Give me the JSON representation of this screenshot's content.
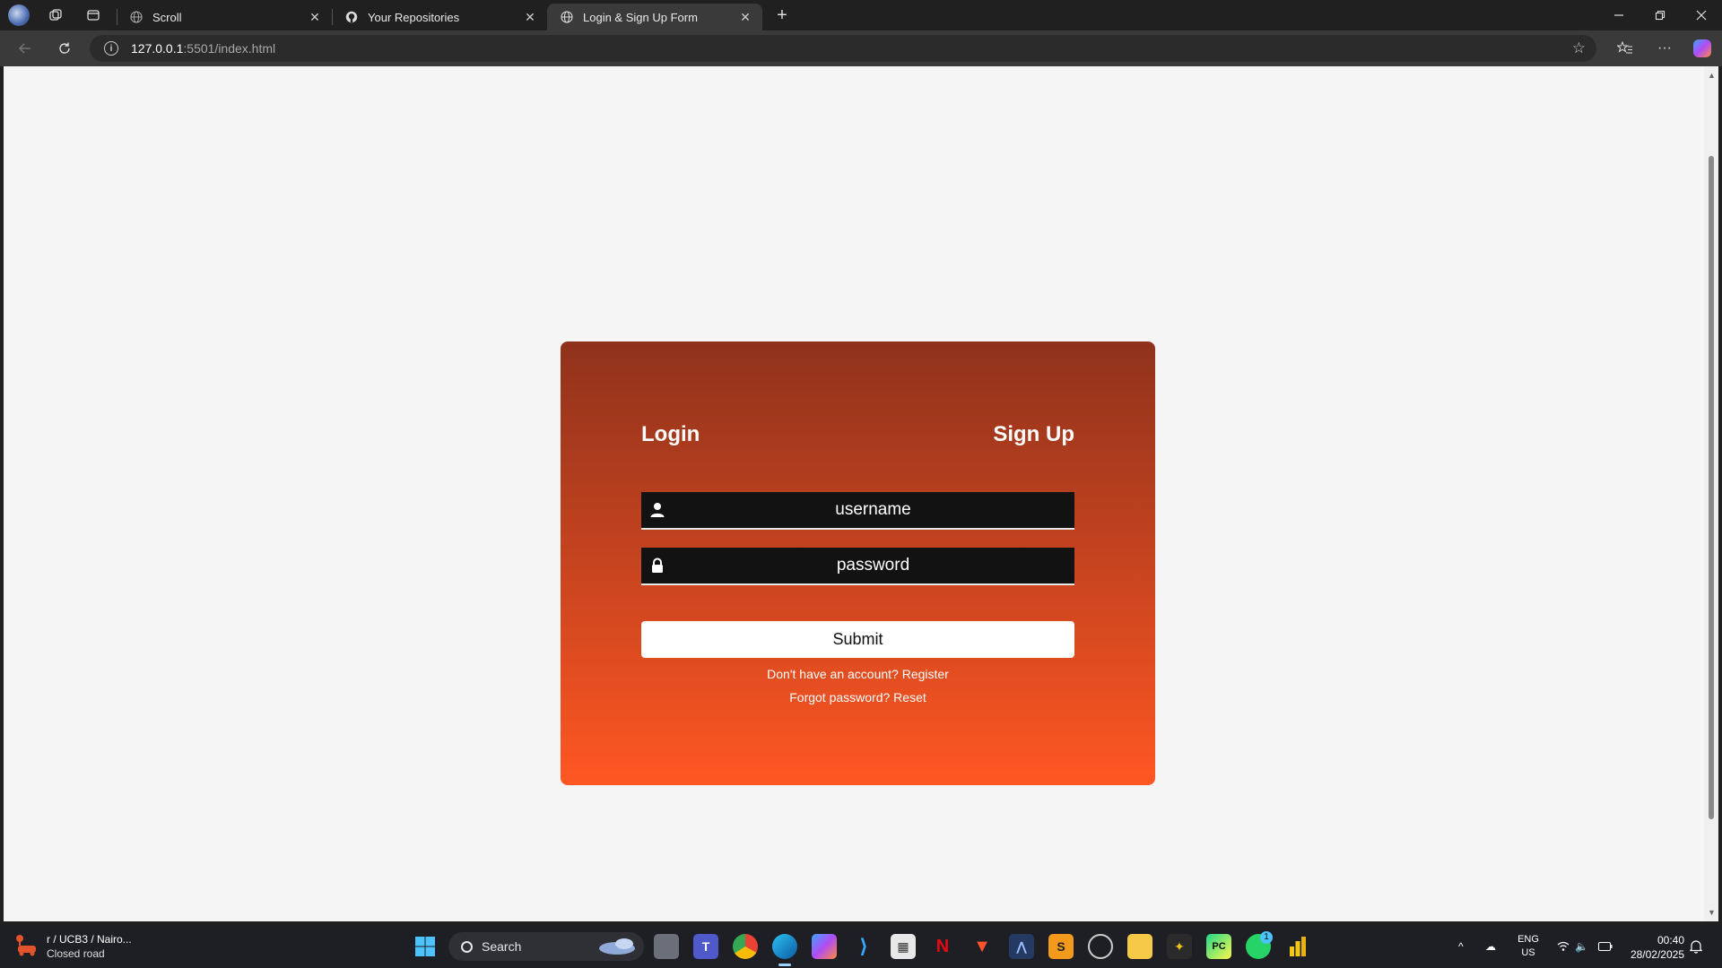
{
  "browser": {
    "tabs": [
      {
        "title": "Scroll",
        "icon": "globe-icon",
        "active": false
      },
      {
        "title": "Your Repositories",
        "icon": "github-icon",
        "active": false
      },
      {
        "title": "Login & Sign Up Form",
        "icon": "globe-icon",
        "active": true
      }
    ],
    "url_host": "127.0.0.1",
    "url_path": ":5501/index.html"
  },
  "form": {
    "login_label": "Login",
    "signup_label": "Sign Up",
    "username_placeholder": "username",
    "password_placeholder": "password",
    "submit_label": "Submit",
    "register_line": "Don't have an account? Register",
    "reset_line": "Forgot password? Reset",
    "gradient_colors": [
      "#8f321b",
      "#ff5722"
    ]
  },
  "taskbar": {
    "weather_title": "r / UCB3 / Nairo...",
    "weather_subtitle": "Closed road",
    "search_label": "Search",
    "language_top": "ENG",
    "language_bottom": "US",
    "time": "00:40",
    "date": "28/02/2025",
    "whatsapp_badge": "1"
  }
}
